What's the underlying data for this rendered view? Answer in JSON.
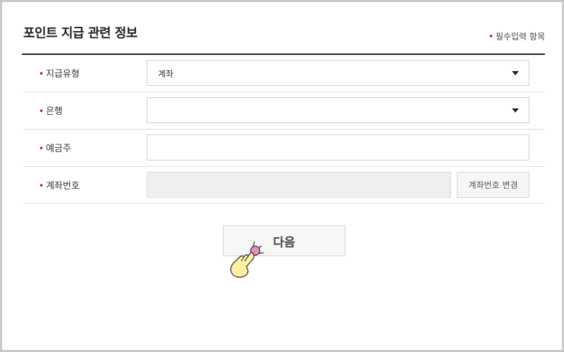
{
  "header": {
    "title": "포인트 지급 관련 정보",
    "required_note": "필수입력 항목"
  },
  "form": {
    "payment_type": {
      "label": "지급유형",
      "value": "계좌"
    },
    "bank": {
      "label": "은행",
      "value": ""
    },
    "account_holder": {
      "label": "예금주",
      "value": ""
    },
    "account_number": {
      "label": "계좌번호",
      "value": "",
      "change_label": "계좌번호 변경"
    }
  },
  "actions": {
    "next_label": "다음"
  },
  "colors": {
    "required_dot": "#d0021b",
    "header_rule": "#222222",
    "disabled_input": "#efefef"
  }
}
